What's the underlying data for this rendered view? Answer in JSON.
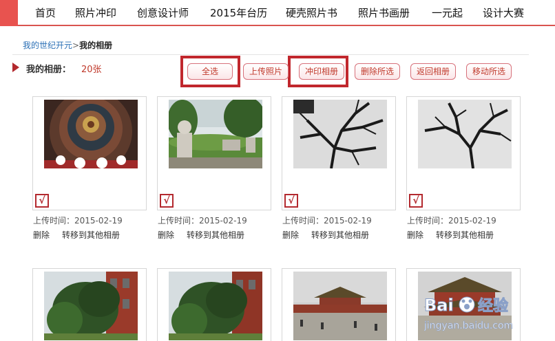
{
  "nav": {
    "items": [
      "首页",
      "照片冲印",
      "创意设计师",
      "2015年台历",
      "硬壳照片书",
      "照片书画册",
      "一元起",
      "设计大赛"
    ]
  },
  "breadcrumb": {
    "home": "我的世纪开元",
    "separator": ">",
    "current": "我的相册"
  },
  "album": {
    "label": "我的相册：",
    "count": "20张"
  },
  "toolbar": {
    "select_all": "全选",
    "upload": "上传照片",
    "print": "冲印相册",
    "delete_selected": "删除所选",
    "back": "返回相册",
    "move_selected": "移动所选"
  },
  "photos": [
    {
      "upload_label": "上传时间：",
      "date": "2015-02-19",
      "checked": true,
      "scene": "dome-ceiling-icon"
    },
    {
      "upload_label": "上传时间：",
      "date": "2015-02-19",
      "checked": true,
      "scene": "garden-statues-icon"
    },
    {
      "upload_label": "上传时间：",
      "date": "2015-02-19",
      "checked": true,
      "scene": "bare-tree-icon"
    },
    {
      "upload_label": "上传时间：",
      "date": "2015-02-19",
      "checked": true,
      "scene": "bare-tree-icon"
    },
    {
      "scene": "pine-tree-wall-icon"
    },
    {
      "scene": "pine-tree-wall-icon"
    },
    {
      "scene": "palace-gate-icon"
    },
    {
      "scene": "palace-hall-icon"
    }
  ],
  "photo_actions": {
    "delete": "删除",
    "move": "转移到其他相册"
  },
  "checkmark": "√",
  "watermark": {
    "brand": "Bai",
    "brand2": "经验",
    "url": "jingyan.baidu.com"
  },
  "colors": {
    "accent": "#c1272d",
    "nav_underline": "#d9534f",
    "link": "#2a6fb5"
  }
}
